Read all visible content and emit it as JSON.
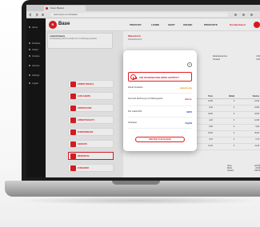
{
  "browser": {
    "tab_title": "Store Basket",
    "url": "www.store.com/basket"
  },
  "sidebar": {
    "items": [
      {
        "label": "Home"
      },
      {
        "label": "Products"
      },
      {
        "label": "Orders"
      },
      {
        "label": "Invoices"
      },
      {
        "label": "Account"
      },
      {
        "label": "Settings"
      },
      {
        "label": "Logout"
      }
    ]
  },
  "header": {
    "logo_letter": "B",
    "logo_text": "Base",
    "nav": [
      "PRODUKT",
      "LEHRE",
      "SHOP",
      "ONLINE",
      "PRODUKTE"
    ],
    "nav_highlight": "Kundendienst"
  },
  "left_panel": {
    "info_title": "Lieferhinweis",
    "info_text": "Ihre Bestellung wird innerhalb von 2-3 Werktagen geliefert.",
    "categories": [
      {
        "label": "ORDER SPECIAL",
        "active": false
      },
      {
        "label": "AUSLAGERN",
        "active": false
      },
      {
        "label": "VERPACKUNG",
        "active": false
      },
      {
        "label": "ARBEITSSCHUTZ",
        "active": false
      },
      {
        "label": "BUEROBEDARF",
        "active": false
      },
      {
        "label": "GERAETE",
        "active": false
      },
      {
        "label": "WERKZEUG",
        "active": true
      },
      {
        "label": "ZUBEHOER",
        "active": false
      }
    ]
  },
  "main": {
    "title": "Warenkorb",
    "subtitle": "Artikelübersicht",
    "summary": [
      {
        "label": "Zwischensumme",
        "value": "0,00"
      },
      {
        "label": "Versand",
        "value": "0,00"
      }
    ],
    "table_headers": [
      "Menge",
      "Preis",
      "Rabatt",
      "Summe"
    ],
    "rows": [
      [
        "1",
        "12,90",
        "0",
        "12,90"
      ],
      [
        "2",
        "8,40",
        "0",
        "16,80"
      ],
      [
        "1",
        "24,50",
        "0",
        "24,50"
      ],
      [
        "3",
        "4,20",
        "0",
        "12,60"
      ],
      [
        "1",
        "9,90",
        "0",
        "9,90"
      ],
      [
        "2",
        "15,00",
        "0",
        "30,00"
      ],
      [
        "1",
        "6,75",
        "0",
        "6,75"
      ],
      [
        "1",
        "11,20",
        "0",
        "11,20"
      ]
    ],
    "totals": [
      {
        "label": "Netto",
        "value": "124,65"
      },
      {
        "label": "MwSt.",
        "value": "23,68"
      },
      {
        "label": "Gesamt",
        "value": "148,33"
      }
    ]
  },
  "modal": {
    "close_glyph": "×",
    "title": "IHR WARENKORB WIRD GEPRÜFT",
    "rows": [
      {
        "label": "Direkt bezahlen",
        "logo": "amazon pay",
        "logo_color": "#f08804"
      },
      {
        "label": "Kauf auf Rechnung mit Zahlungsziel",
        "logo": "Klarna.",
        "logo_color": "#e31e24"
      },
      {
        "label": "Per Lastschrift",
        "logo": "SEPA",
        "logo_color": "#1f4aa8"
      },
      {
        "label": "Vorkasse",
        "logo": "PayPal",
        "logo_color": "#1f3f8a"
      }
    ],
    "button_label": "WEITER ZUR KASSE"
  },
  "colors": {
    "accent": "#e31e24",
    "sidebar_bg": "#161616"
  }
}
